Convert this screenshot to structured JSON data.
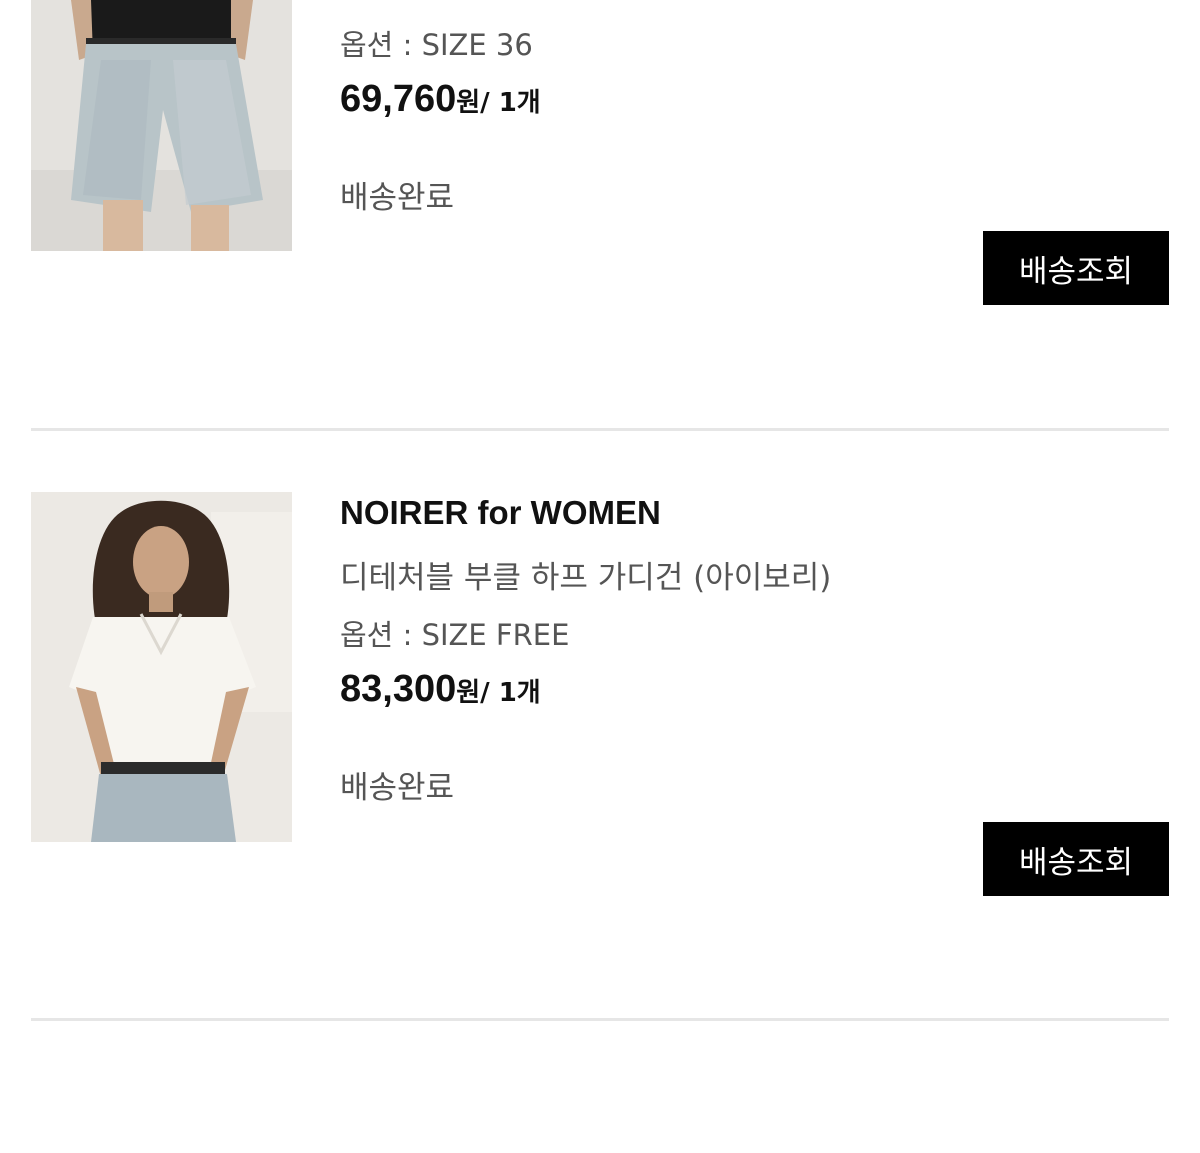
{
  "orders": [
    {
      "product_name": "",
      "option": "옵션 : SIZE 36",
      "price": "69,760",
      "currency": "원",
      "quantity": "/ 1개",
      "status": "배송완료",
      "track_button": "배송조회"
    },
    {
      "brand": "NOIRER for WOMEN",
      "product_name": "디테처블 부클 하프 가디건 (아이보리)",
      "option": "옵션 : SIZE FREE",
      "price": "83,300",
      "currency": "원",
      "quantity": "/ 1개",
      "status": "배송완료",
      "track_button": "배송조회"
    }
  ],
  "colors": {
    "button_bg": "#000000",
    "button_text": "#ffffff",
    "muted_text": "#555555",
    "divider": "#e6e6e6"
  }
}
